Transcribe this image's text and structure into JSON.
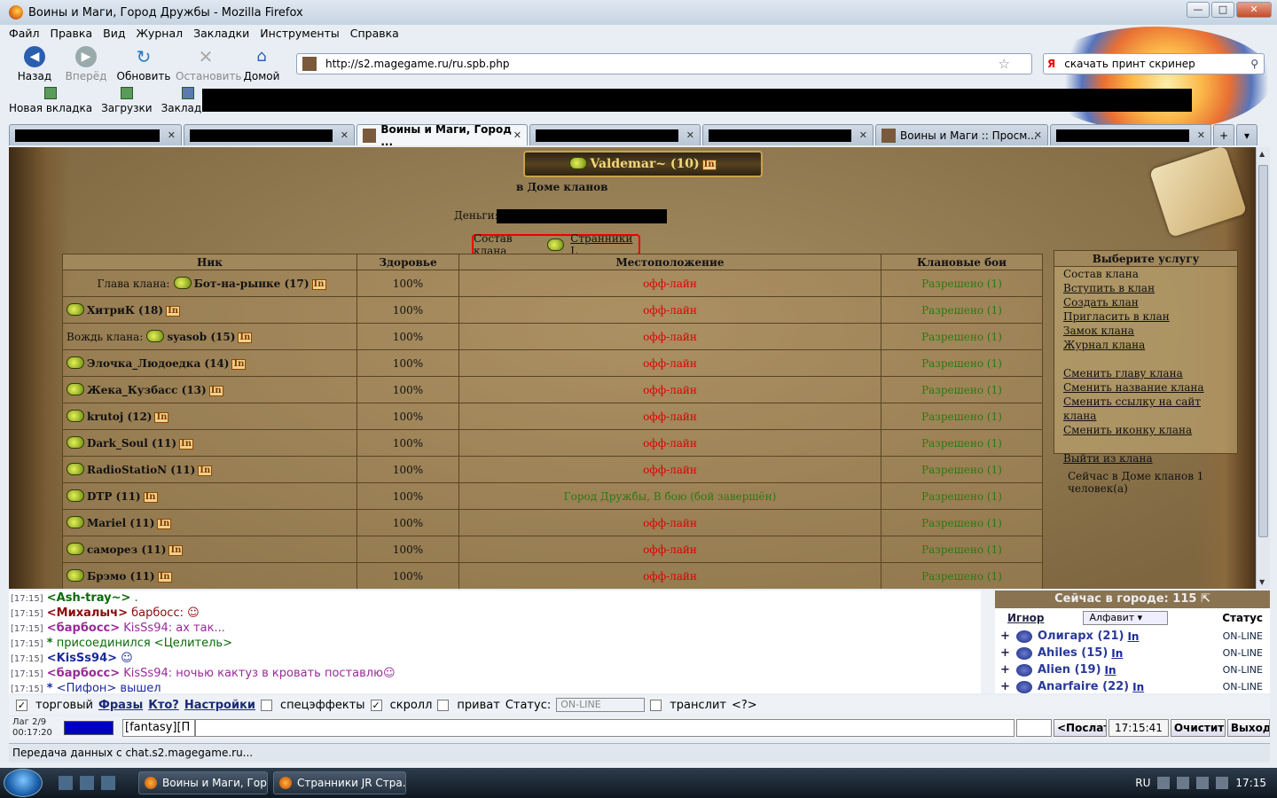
{
  "window": {
    "title": "Воины и Маги, Город Дружбы - Mozilla Firefox"
  },
  "menu": [
    "Файл",
    "Правка",
    "Вид",
    "Журнал",
    "Закладки",
    "Инструменты",
    "Справка"
  ],
  "nav": {
    "back": "Назад",
    "forward": "Вперёд",
    "reload": "Обновить",
    "stop": "Остановить",
    "home": "Домой",
    "url": "http://s2.magegame.ru/ru.spb.php",
    "search_engine": "Я",
    "search": "скачать принт скринер"
  },
  "bookmarks": [
    "Новая вкладка",
    "Загрузки",
    "Закладки"
  ],
  "tabs": {
    "active": "Воины и Маги, Город ...",
    "other": "Воины и Маги :: Просм..."
  },
  "page": {
    "player": "Valdemar~ (10)",
    "location": "в Доме кланов",
    "money_label": "Деньги:",
    "clan_label": "Состав клана",
    "clan_name": " Странники L",
    "headers": [
      "Ник",
      "Здоровье",
      "Местоположение",
      "Клановые бои"
    ],
    "rows": [
      {
        "prefix": "Глава клана:",
        "nick": "Бот-на-рынке (17)",
        "hp": "100%",
        "loc": "офф-лайн",
        "fight": "Разрешено (1)"
      },
      {
        "prefix": "",
        "nick": "ХитриК (18)",
        "hp": "100%",
        "loc": "офф-лайн",
        "fight": "Разрешено (1)"
      },
      {
        "prefix": "Вождь клана:",
        "nick": "syasob (15)",
        "hp": "100%",
        "loc": "офф-лайн",
        "fight": "Разрешено (1)"
      },
      {
        "prefix": "",
        "nick": "Элочка_Людоедка (14)",
        "hp": "100%",
        "loc": "офф-лайн",
        "fight": "Разрешено (1)"
      },
      {
        "prefix": "",
        "nick": "Жека_Кузбасс (13)",
        "hp": "100%",
        "loc": "офф-лайн",
        "fight": "Разрешено (1)"
      },
      {
        "prefix": "",
        "nick": "krutoj (12)",
        "hp": "100%",
        "loc": "офф-лайн",
        "fight": "Разрешено (1)"
      },
      {
        "prefix": "",
        "nick": "Dark_Soul (11)",
        "hp": "100%",
        "loc": "офф-лайн",
        "fight": "Разрешено (1)"
      },
      {
        "prefix": "",
        "nick": "RadioStatioN (11)",
        "hp": "100%",
        "loc": "офф-лайн",
        "fight": "Разрешено (1)"
      },
      {
        "prefix": "",
        "nick": "DTP (11)",
        "hp": "100%",
        "loc": "Город Дружбы, В бою (бой завершён)",
        "fight": "Разрешено (1)"
      },
      {
        "prefix": "",
        "nick": "Mariel (11)",
        "hp": "100%",
        "loc": "офф-лайн",
        "fight": "Разрешено (1)"
      },
      {
        "prefix": "",
        "nick": "саморез (11)",
        "hp": "100%",
        "loc": "офф-лайн",
        "fight": "Разрешено (1)"
      },
      {
        "prefix": "",
        "nick": "Брэмо (11)",
        "hp": "100%",
        "loc": "офф-лайн",
        "fight": "Разрешено (1)"
      }
    ],
    "services_title": "Выберите услугу",
    "services": [
      "Состав клана",
      "Вступить в клан",
      "Создать клан",
      "Пригласить в клан",
      "Замок клана",
      "Журнал клана",
      "Сменить главу клана",
      "Сменить название клана",
      "Сменить ссылку на сайт клана",
      "Сменить иконку клана",
      "Выйти из клана"
    ],
    "now_in_house": "Сейчас в Доме кланов 1 человек(а)"
  },
  "chat": [
    {
      "ts": "[17:15]",
      "nick": "<Ash-tray~>",
      "text": " .",
      "color": "#0a6a0a"
    },
    {
      "ts": "[17:15]",
      "nick": "<Михалыч>",
      "text": " барбосс: ☺",
      "color": "#8a0a0a"
    },
    {
      "ts": "[17:15]",
      "nick": "<барбосс>",
      "text": " KisSs94: ах так...",
      "color": "#9a2a9a"
    },
    {
      "ts": "[17:15]",
      "nick": "*",
      "text": " присоединился <Целитель>",
      "color": "#0a6a0a"
    },
    {
      "ts": "[17:15]",
      "nick": "<KisSs94>",
      "text": " ☺",
      "color": "#1a2a9a"
    },
    {
      "ts": "[17:15]",
      "nick": "<барбосс>",
      "text": " KisSs94: ночью кактуз в кровать поставлю☺",
      "color": "#9a2a9a"
    },
    {
      "ts": "[17:15]",
      "nick": "*",
      "text": " <Пифон> вышел",
      "color": "#1a2a9a"
    }
  ],
  "online": {
    "title": "Сейчас в городе: 115",
    "ignore": "Игнор",
    "sort": "Алфавит",
    "status_header": "Статус",
    "users": [
      {
        "name": "Олигарх (21)",
        "status": "ON-LINE"
      },
      {
        "name": "Ahiles (15)",
        "status": "ON-LINE"
      },
      {
        "name": "Alien (19)",
        "status": "ON-LINE"
      },
      {
        "name": "Anarfaire (22)",
        "status": "ON-LINE"
      }
    ]
  },
  "options": {
    "trade": "торговый",
    "phrases": "Фразы",
    "who": "Кто?",
    "settings": "Настройки",
    "effects": "спецэффекты",
    "scroll": "скролл",
    "private": "приват",
    "status_label": "Статус:",
    "status_value": "ON-LINE",
    "translit": "транслит",
    "translit_help": "<?>"
  },
  "input": {
    "lag": "Лаг 2/9",
    "timer": "00:17:20",
    "prefix": "[fantasy][П",
    "send": "<Послать",
    "time": "17:15:41",
    "clear": "Очистить",
    "exit": "Выход"
  },
  "statusbar": "Передача данных с chat.s2.magegame.ru...",
  "taskbar": {
    "tasks": [
      "Воины и Маги, Гор...",
      "Странники JR Стра..."
    ],
    "lang": "RU",
    "clock": "17:15"
  }
}
